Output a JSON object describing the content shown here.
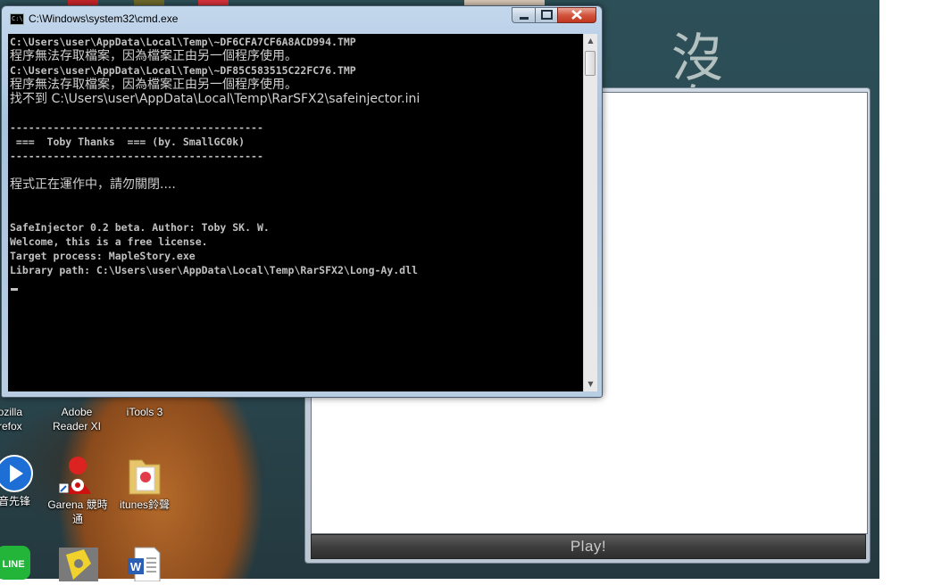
{
  "cmd": {
    "title": "C:\\Windows\\system32\\cmd.exe",
    "lines": [
      {
        "text": "C:\\Users\\user\\AppData\\Local\\Temp\\~DF6CFA7CF6A8ACD994.TMP",
        "cjk": false
      },
      {
        "text": "程序無法存取檔案，因為檔案正由另一個程序使用。",
        "cjk": true
      },
      {
        "text": "C:\\Users\\user\\AppData\\Local\\Temp\\~DF85C583515C22FC76.TMP",
        "cjk": false
      },
      {
        "text": "程序無法存取檔案，因為檔案正由另一個程序使用。",
        "cjk": true
      },
      {
        "text": "找不到 C:\\Users\\user\\AppData\\Local\\Temp\\RarSFX2\\safeinjector.ini",
        "cjk": true
      },
      {
        "text": "",
        "cjk": false
      },
      {
        "text": "-----------------------------------------",
        "cjk": false
      },
      {
        "text": " ===  Toby Thanks  === (by. SmallGC0k)",
        "cjk": false
      },
      {
        "text": "-----------------------------------------",
        "cjk": false
      },
      {
        "text": "",
        "cjk": false
      },
      {
        "text": "程式正在運作中，請勿關閉....",
        "cjk": true
      },
      {
        "text": "",
        "cjk": false
      },
      {
        "text": "",
        "cjk": false
      },
      {
        "text": "SafeInjector 0.2 beta. Author: Toby SK. W.",
        "cjk": false
      },
      {
        "text": "Welcome, this is a free license.",
        "cjk": false
      },
      {
        "text": "Target process: MapleStory.exe",
        "cjk": false
      },
      {
        "text": "Library path: C:\\Users\\user\\AppData\\Local\\Temp\\RarSFX2\\Long-Ay.dll",
        "cjk": false
      }
    ]
  },
  "game": {
    "play_label": "Play!"
  },
  "desktop": {
    "icons": [
      {
        "label": "lozilla\nirefox",
        "icon": "firefox-icon"
      },
      {
        "label": "Adobe\nReader XI",
        "icon": "adobe-reader-icon"
      },
      {
        "label": "iTools 3",
        "icon": "itools-icon"
      },
      {
        "label": "音先锋",
        "icon": "media-player-icon"
      },
      {
        "label": "Garena 競時\n通",
        "icon": "garena-icon"
      },
      {
        "label": "itunes鈴聲",
        "icon": "folder-icon"
      },
      {
        "label": "",
        "icon": "line-icon"
      },
      {
        "label": "",
        "icon": "yellow-app-icon"
      },
      {
        "label": "",
        "icon": "word-document-icon"
      }
    ],
    "chalk_text": "沒 有"
  }
}
